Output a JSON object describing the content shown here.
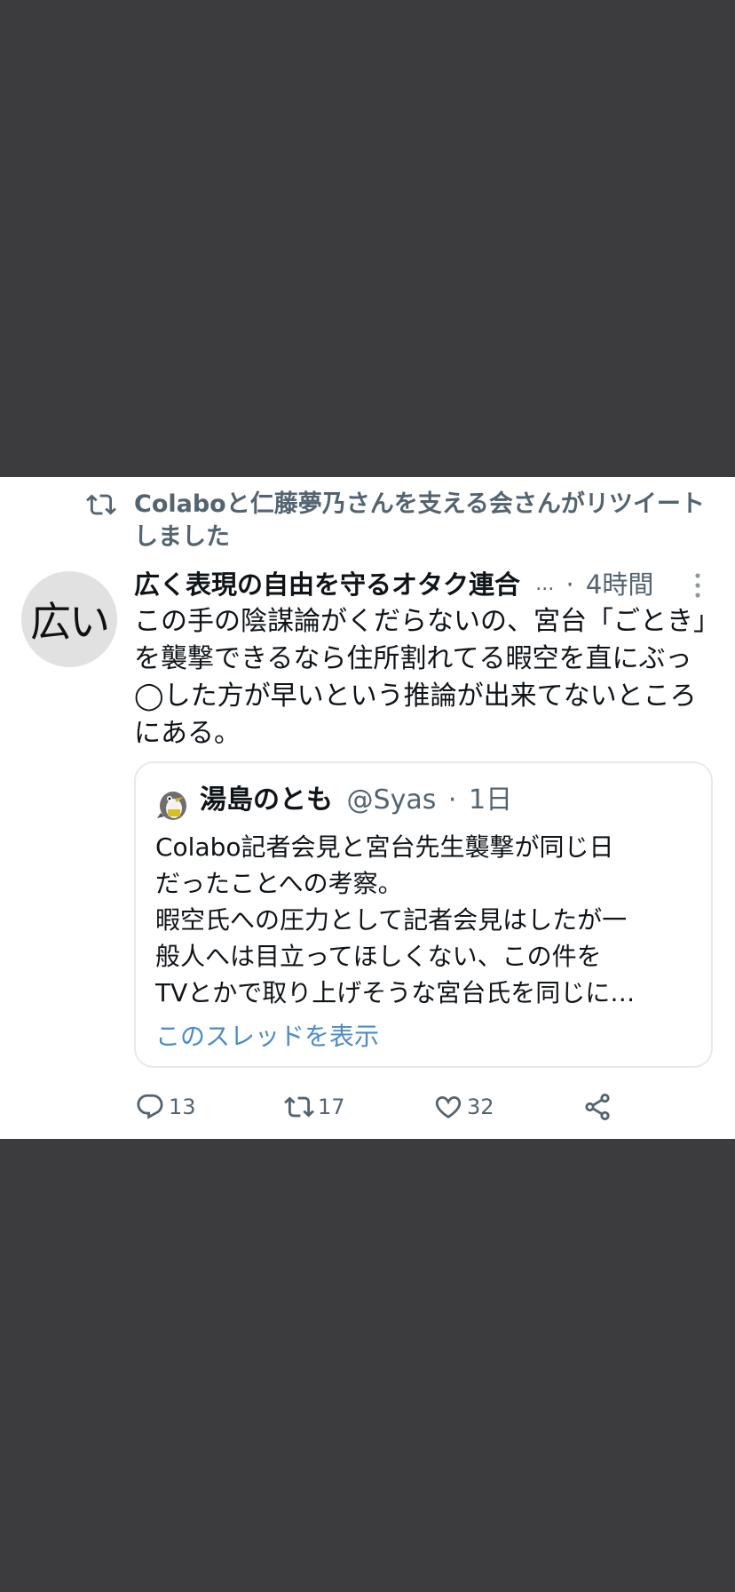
{
  "retweet_context": {
    "text": "Colaboと仁藤夢乃さんを支える会さんがリツイートしました",
    "icon": "retweet-icon"
  },
  "tweet": {
    "avatar_text": "広い",
    "display_name": "広く表現の自由を守るオタク連合",
    "ellipsis": "...",
    "separator": "·",
    "time": "4時間",
    "body": "この手の陰謀論がくだらないの、宮台「ごとき」を襲撃できるなら住所割れてる暇空を直にぶっ◯した方が早いという推論が出来てないところにある。",
    "more_icon": "more-vertical-icon"
  },
  "quote": {
    "avatar_icon": "penguin-avatar-icon",
    "display_name": "湯島のとも",
    "handle": "@Syas",
    "separator": "·",
    "time": "1日",
    "lines": [
      "Colabo記者会見と宮台先生襲撃が同じ日",
      "だったことへの考察。",
      "暇空氏への圧力として記者会見はしたが一",
      "般人へは目立ってほしくない、この件を",
      "TVとかで取り上げそうな宮台氏を同じに…"
    ],
    "show_thread": "このスレッドを表示",
    "link_color": "#4a8bc9"
  },
  "actions": {
    "reply_count": "13",
    "retweet_count": "17",
    "like_count": "32",
    "icons": [
      "reply-icon",
      "retweet-icon",
      "like-icon",
      "share-icon"
    ]
  },
  "colors": {
    "background": "#3c3c3e",
    "card": "#ffffff",
    "text_primary": "#0f1419",
    "text_secondary": "#536471"
  }
}
